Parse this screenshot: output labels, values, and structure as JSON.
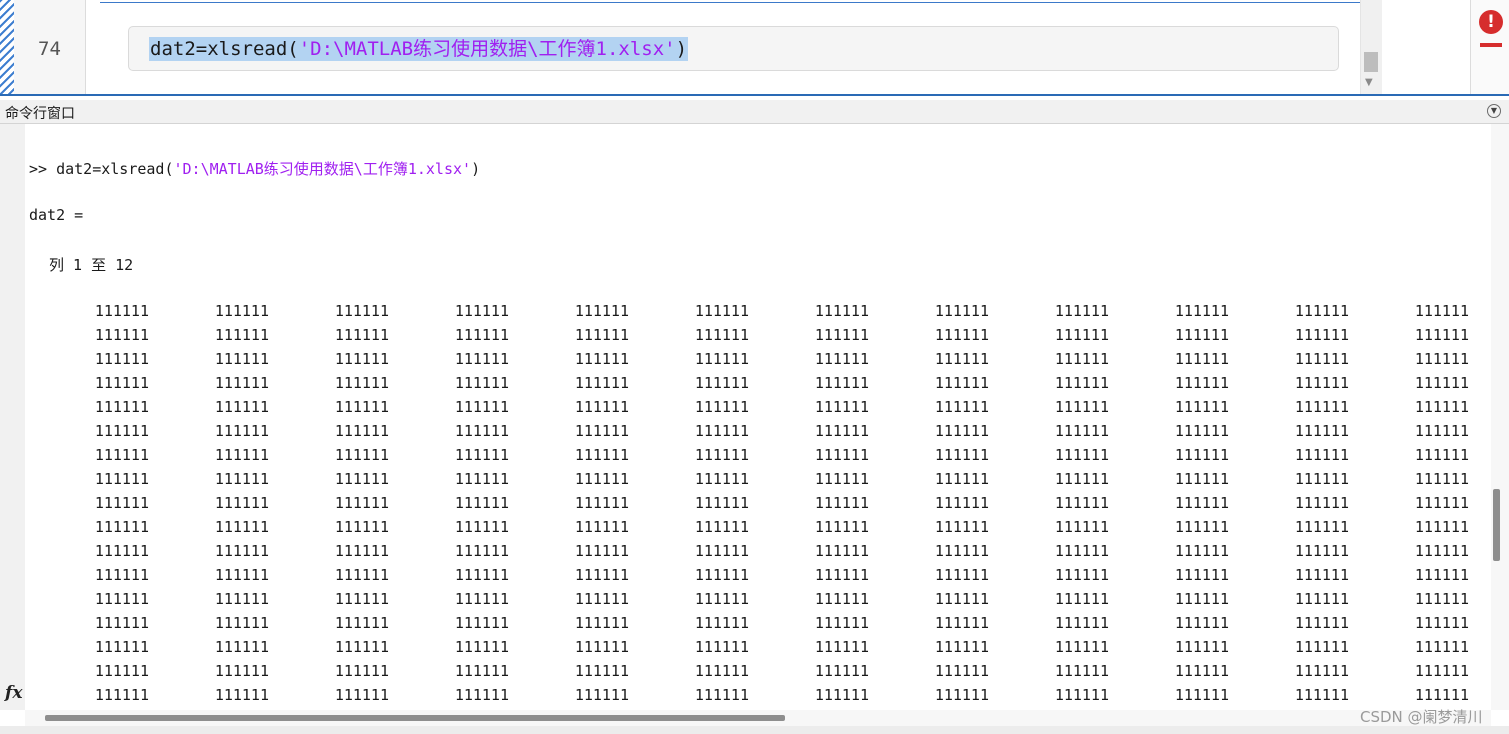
{
  "editor": {
    "line_number": "74",
    "code_prefix": "dat2=xlsread(",
    "code_string": "'D:\\MATLAB练习使用数据\\工作簿1.xlsx'",
    "code_suffix": ")"
  },
  "command_window": {
    "title": "命令行窗口",
    "prompt": ">> ",
    "command_prefix": "dat2=xlsread(",
    "command_string": "'D:\\MATLAB练习使用数据\\工作簿1.xlsx'",
    "command_suffix": ")",
    "variable_line": "dat2 =",
    "columns_label": "列 1 至 12",
    "matrix_value": "111111",
    "matrix_visible_rows": 17,
    "matrix_visible_columns": 12
  },
  "watermark": "CSDN @阑梦清川",
  "colors": {
    "string": "#a020f0",
    "selection": "#b3d3f2",
    "error": "#d62d2d"
  },
  "icons": {
    "error": "error-icon",
    "fx": "fx-icon",
    "menu": "chevron-down-icon"
  }
}
